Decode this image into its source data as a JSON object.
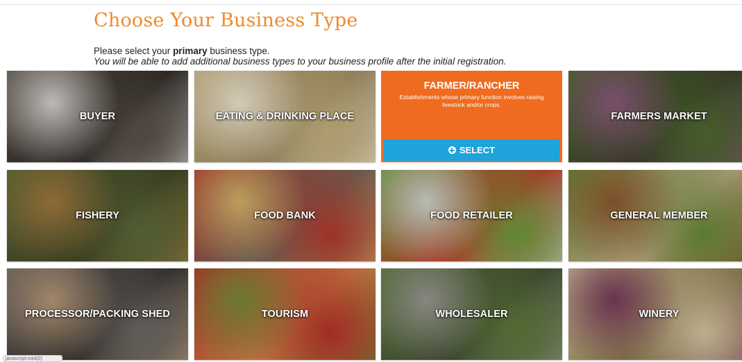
{
  "page": {
    "title": "Choose Your Business Type",
    "instruction_prefix": "Please select your ",
    "instruction_bold": "primary",
    "instruction_suffix": " business type.",
    "instruction_line2": "You will be able to add additional business types to your business profile after the initial registration."
  },
  "tiles": [
    {
      "label": "BUYER",
      "bg_icon": "dairy-cows-image",
      "colors": [
        "#5a5148",
        "#d8d4cf",
        "#2b2724"
      ]
    },
    {
      "label": "EATING & DRINKING PLACE",
      "bg_icon": "table-setting-image",
      "colors": [
        "#c7b27e",
        "#efe6d2",
        "#9c8a62"
      ]
    },
    {
      "label": "FARMER/RANCHER",
      "active": true,
      "description": "Establishments whose primary function involves raising livestock and/or crops.",
      "select_label": "SELECT",
      "accent": "#ef6b1f",
      "button_color": "#1ea3db"
    },
    {
      "label": "FARMERS MARKET",
      "bg_icon": "produce-stand-image",
      "colors": [
        "#4e6b2f",
        "#8a5a7a",
        "#3a3a2a"
      ]
    },
    {
      "label": "FISHERY",
      "bg_icon": "fish-image",
      "colors": [
        "#5d6b3a",
        "#a07a3e",
        "#3b3f22"
      ]
    },
    {
      "label": "FOOD BANK",
      "bg_icon": "canned-goods-image",
      "colors": [
        "#b33a2e",
        "#d7b46a",
        "#6f6a5e"
      ]
    },
    {
      "label": "FOOD RETAILER",
      "bg_icon": "grocery-cart-image",
      "colors": [
        "#6f9b3a",
        "#d2d6cf",
        "#c43a2a"
      ]
    },
    {
      "label": "GENERAL MEMBER",
      "bg_icon": "vegetable-crate-image",
      "colors": [
        "#6a8a3a",
        "#8e5a2f",
        "#c9b48e"
      ]
    },
    {
      "label": "PROCESSOR/PACKING SHED",
      "bg_icon": "packing-line-image",
      "colors": [
        "#6e6a66",
        "#b99a7a",
        "#2f2c2a"
      ]
    },
    {
      "label": "TOURISM",
      "bg_icon": "apple-basket-image",
      "colors": [
        "#b8322a",
        "#7a8a3a",
        "#d98a4a"
      ]
    },
    {
      "label": "WHOLESALER",
      "bg_icon": "produce-crates-image",
      "colors": [
        "#5e7a3a",
        "#9a9a92",
        "#3f4a32"
      ]
    },
    {
      "label": "WINERY",
      "bg_icon": "vineyard-image",
      "colors": [
        "#d7c8a2",
        "#7a3a5a",
        "#8a7a4a"
      ]
    }
  ],
  "status_bar": {
    "text": "javascript:void(0)"
  }
}
